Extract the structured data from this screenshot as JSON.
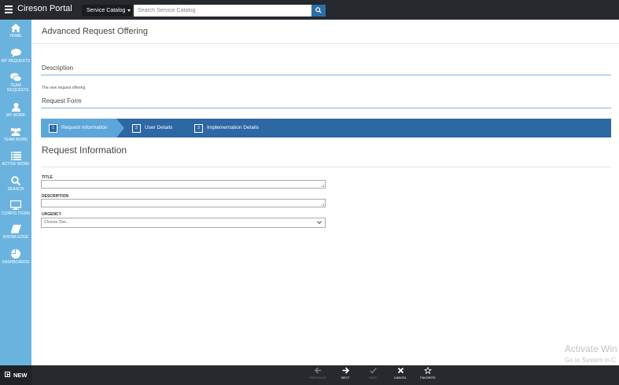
{
  "topbar": {
    "brand": "Cireson Portal",
    "catalog_label": "Service Catalog",
    "search_placeholder": "Search Service Catalog"
  },
  "sidebar": {
    "items": [
      {
        "label": "HOME",
        "icon": "home-icon"
      },
      {
        "label": "MY REQUESTS",
        "icon": "speech-bubble-icon"
      },
      {
        "label": "TEAM REQUESTS",
        "icon": "speech-bubbles-icon"
      },
      {
        "label": "MY WORK",
        "icon": "user-icon"
      },
      {
        "label": "TEAM WORK",
        "icon": "users-icon"
      },
      {
        "label": "ACTIVE WORK",
        "icon": "list-icon"
      },
      {
        "label": "SEARCH",
        "icon": "search-icon"
      },
      {
        "label": "CONFIG ITEMS",
        "icon": "monitor-icon"
      },
      {
        "label": "KNOWLEDGE",
        "icon": "book-icon"
      },
      {
        "label": "DASHBOARDS",
        "icon": "pie-chart-icon"
      }
    ]
  },
  "main": {
    "page_title": "Advanced Request Offering",
    "description_heading": "Description",
    "description_text": "The new request offering.",
    "request_form_heading": "Request Form",
    "wizard_steps": [
      {
        "number": "1",
        "label": "Request Information",
        "active": true
      },
      {
        "number": "2",
        "label": "User Details",
        "active": false
      },
      {
        "number": "3",
        "label": "Implementation Details",
        "active": false
      }
    ],
    "section_heading": "Request Information",
    "fields": {
      "title_label": "TITLE",
      "description_label": "DESCRIPTION",
      "urgency_label": "URGENCY",
      "urgency_value": "Choose One..."
    }
  },
  "watermark": {
    "line1": "Activate Win",
    "line2": "Go to System in C"
  },
  "bottombar": {
    "new_label": "NEW",
    "actions": [
      {
        "label": "PREVIOUS",
        "icon": "arrow-left-icon",
        "enabled": false
      },
      {
        "label": "NEXT",
        "icon": "arrow-right-icon",
        "enabled": true
      },
      {
        "label": "SAVE",
        "icon": "check-icon",
        "enabled": false
      },
      {
        "label": "CANCEL",
        "icon": "x-icon",
        "enabled": true
      },
      {
        "label": "FAVORITE",
        "icon": "star-icon",
        "enabled": true
      }
    ]
  },
  "colors": {
    "sidebar": "#6bb3df",
    "topbar": "#26292e",
    "wizard_bar": "#2d67a4",
    "wizard_active": "#5ca6d9"
  }
}
